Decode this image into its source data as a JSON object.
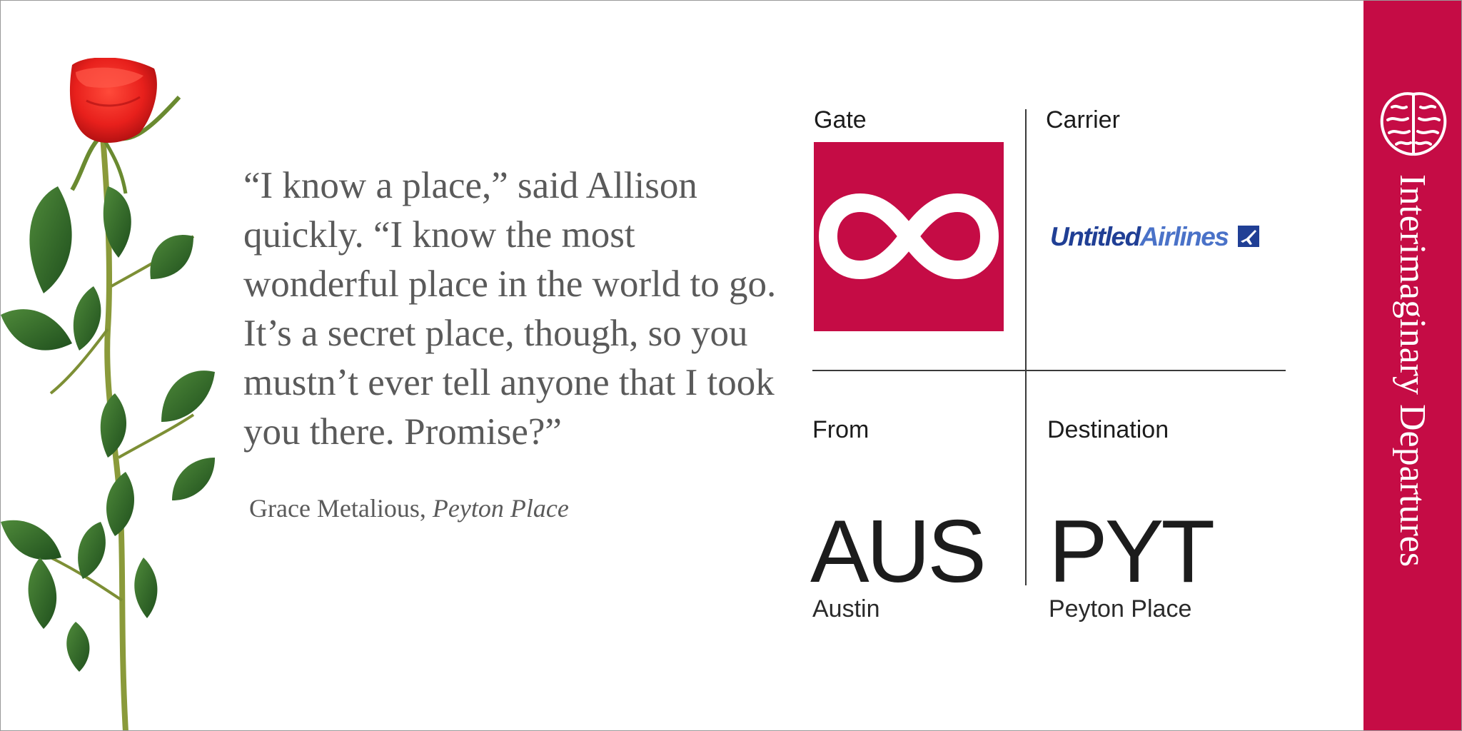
{
  "quote": {
    "text": "“I know a place,” said Allison quickly. “I know the most wonderful place in the world to go. It’s a secret place, though, so you mustn’t ever tell anyone that I took you there. Promise?”",
    "author": "Grace Metalious,",
    "work": "Peyton Place"
  },
  "ticket": {
    "gate_label": "Gate",
    "carrier_label": "Carrier",
    "from_label": "From",
    "destination_label": "Destination",
    "gate_icon": "infinity-icon",
    "carrier_name_part1": "Untitled",
    "carrier_name_part2": "Airlines",
    "from_code": "AUS",
    "from_city": "Austin",
    "destination_code": "PYT",
    "destination_city": "Peyton Place"
  },
  "sidebar": {
    "title": "Interimaginary Departures",
    "logo_icon": "brain-icon"
  },
  "colors": {
    "accent": "#c50c45",
    "carrier_dark": "#203f95",
    "carrier_light": "#4a72c8",
    "text": "#5a5a5a"
  }
}
